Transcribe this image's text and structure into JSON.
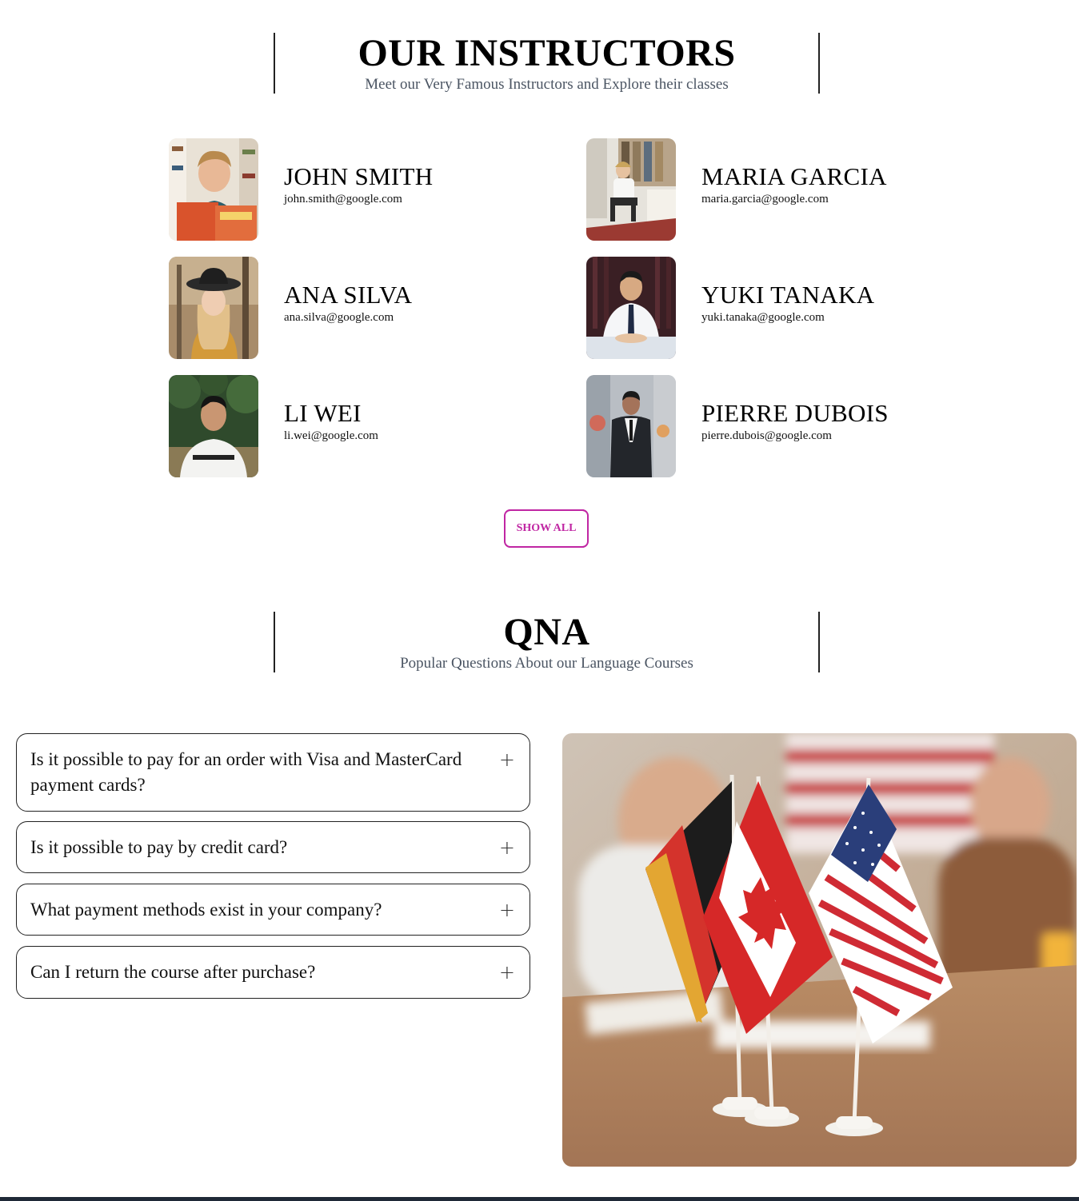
{
  "instructors_section": {
    "title": "OUR INSTRUCTORS",
    "subtitle": "Meet our Very Famous Instructors and Explore their classes"
  },
  "instructors": [
    {
      "name": "JOHN SMITH",
      "email": "john.smith@google.com"
    },
    {
      "name": "MARIA GARCIA",
      "email": "maria.garcia@google.com"
    },
    {
      "name": "ANA SILVA",
      "email": "ana.silva@google.com"
    },
    {
      "name": "YUKI TANAKA",
      "email": "yuki.tanaka@google.com"
    },
    {
      "name": "LI WEI",
      "email": "li.wei@google.com"
    },
    {
      "name": "PIERRE DUBOIS",
      "email": "pierre.dubois@google.com"
    }
  ],
  "show_all_label": "SHOW ALL",
  "qna_section": {
    "title": "QNA",
    "subtitle": "Popular Questions About our Language Courses"
  },
  "faqs": [
    {
      "question": "Is it possible to pay for an order with Visa and MasterCard payment cards?",
      "icon": "plus-icon"
    },
    {
      "question": "Is it possible to pay by credit card?",
      "icon": "plus-icon"
    },
    {
      "question": "What payment methods exist in your company?",
      "icon": "plus-icon"
    },
    {
      "question": "Can I return the course after purchase?",
      "icon": "plus-icon"
    }
  ],
  "colors": {
    "accent": "#c026a3",
    "heading": "#000000",
    "subtitle": "#4b5563",
    "footer": "#1f2937"
  }
}
